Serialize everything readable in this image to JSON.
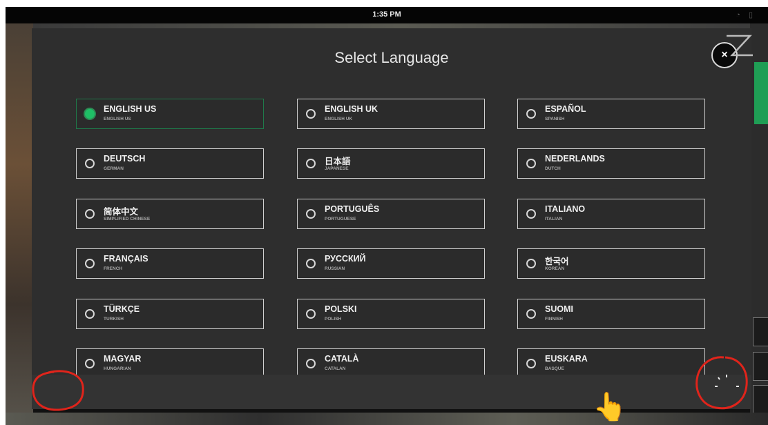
{
  "status_bar": {
    "time": "1:35 PM",
    "icons": [
      "wifi-icon",
      "battery-icon"
    ]
  },
  "modal": {
    "title": "Select Language",
    "close_label": "×",
    "languages": [
      {
        "name": "ENGLISH US",
        "sub": "ENGLISH US",
        "selected": true
      },
      {
        "name": "ENGLISH UK",
        "sub": "ENGLISH UK",
        "selected": false
      },
      {
        "name": "ESPAÑOL",
        "sub": "SPANISH",
        "selected": false
      },
      {
        "name": "DEUTSCH",
        "sub": "GERMAN",
        "selected": false
      },
      {
        "name": "日本語",
        "sub": "JAPANESE",
        "selected": false
      },
      {
        "name": "NEDERLANDS",
        "sub": "DUTCH",
        "selected": false
      },
      {
        "name": "简体中文",
        "sub": "SIMPLIFIED CHINESE",
        "selected": false
      },
      {
        "name": "PORTUGUÊS",
        "sub": "PORTUGUESE",
        "selected": false
      },
      {
        "name": "ITALIANO",
        "sub": "ITALIAN",
        "selected": false
      },
      {
        "name": "FRANÇAIS",
        "sub": "FRENCH",
        "selected": false
      },
      {
        "name": "РУССКИЙ",
        "sub": "RUSSIAN",
        "selected": false
      },
      {
        "name": "한국어",
        "sub": "KOREAN",
        "selected": false
      },
      {
        "name": "TÜRKÇE",
        "sub": "TURKISH",
        "selected": false
      },
      {
        "name": "POLSKI",
        "sub": "POLISH",
        "selected": false
      },
      {
        "name": "SUOMI",
        "sub": "FINNISH",
        "selected": false
      },
      {
        "name": "MAGYAR",
        "sub": "HUNGARIAN",
        "selected": false
      },
      {
        "name": "CATALÀ",
        "sub": "CATALAN",
        "selected": false
      },
      {
        "name": "EUSKARA",
        "sub": "BASQUE",
        "selected": false
      }
    ]
  },
  "colors": {
    "accent": "#1fbf66",
    "modal_bg": "#2e2e2e",
    "button_border": "#d0d0d0",
    "annotation": "#e0241b"
  },
  "annotations": {
    "pointer_icon": "👆"
  }
}
